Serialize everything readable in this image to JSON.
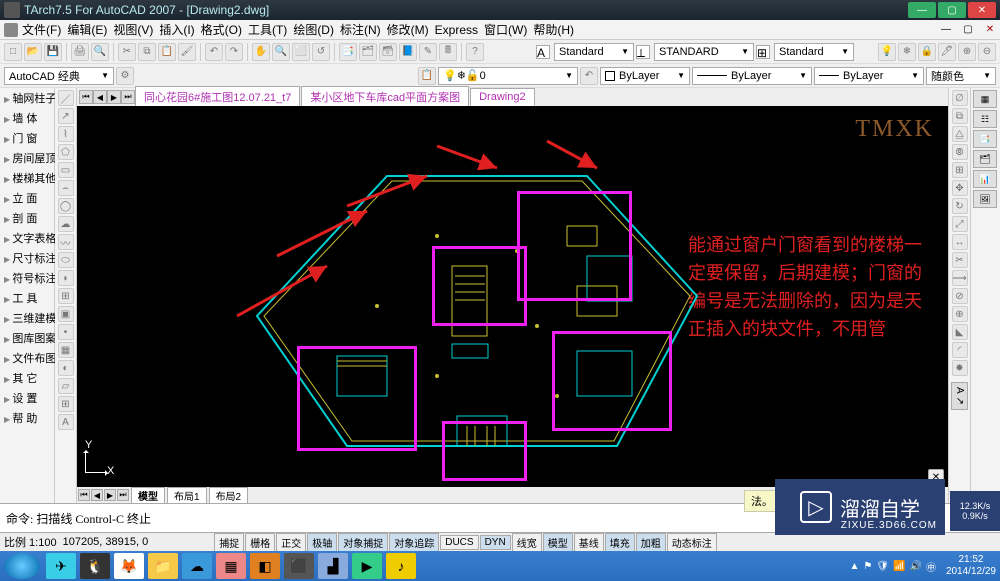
{
  "title": "TArch7.5 For AutoCAD 2007 - [Drawing2.dwg]",
  "menu": [
    "文件(F)",
    "编辑(E)",
    "视图(V)",
    "插入(I)",
    "格式(O)",
    "工具(T)",
    "绘图(D)",
    "标注(N)",
    "修改(M)",
    "Express",
    "窗口(W)",
    "帮助(H)"
  ],
  "workspace": {
    "label": "AutoCAD 经典"
  },
  "style_combos": {
    "text": "Standard",
    "dim": "STANDARD",
    "table": "Standard"
  },
  "layer": {
    "name": "0",
    "color": "ByLayer",
    "linetype": "ByLayer",
    "lineweight": "ByLayer",
    "plotstyle": "随颜色"
  },
  "dwg_tabs": [
    "同心花园6#施工图12.07.21_t7",
    "某小区地下车库cad平面方案图",
    "Drawing2"
  ],
  "dwg_active": 2,
  "palette_items": [
    "轴网柱子",
    "墙 体",
    "门 窗",
    "房间屋顶",
    "楼梯其他",
    "立 面",
    "剖 面",
    "文字表格",
    "尺寸标注",
    "符号标注",
    "工 具",
    "三维建模",
    "图库图案",
    "文件布图",
    "其 它",
    "设 置",
    "帮 助"
  ],
  "model_tabs": {
    "model": "模型",
    "layouts": [
      "布局1",
      "布局2"
    ]
  },
  "watermark": "TMXK",
  "annotation": "能通过窗户门窗看到的楼梯一定要保留，后期建模；门窗的编号是无法删除的，因为是天正插入的块文件，不用管",
  "ucs": {
    "x": "X",
    "y": "Y"
  },
  "command_line": "命令: 扫描线 Control-C 终止",
  "tutorial_tip": "法。",
  "status": {
    "scale": "比例 1:100",
    "coords": "107205, 38915, 0",
    "toggles": [
      "捕捉",
      "栅格",
      "正交",
      "极轴",
      "对象捕捉",
      "对象追踪",
      "DUCS",
      "DYN",
      "线宽",
      "模型",
      "基线",
      "填充",
      "加粗",
      "动态标注"
    ]
  },
  "right_tab": {
    "a": "A",
    "arrow": "↗"
  },
  "net": {
    "down": "12.3K/s",
    "up": "0.9K/s"
  },
  "logo": {
    "text": "溜溜自学",
    "url": "ZIXUE.3D66.COM"
  },
  "clock": {
    "time": "21:52",
    "date": "2014/12/29"
  }
}
